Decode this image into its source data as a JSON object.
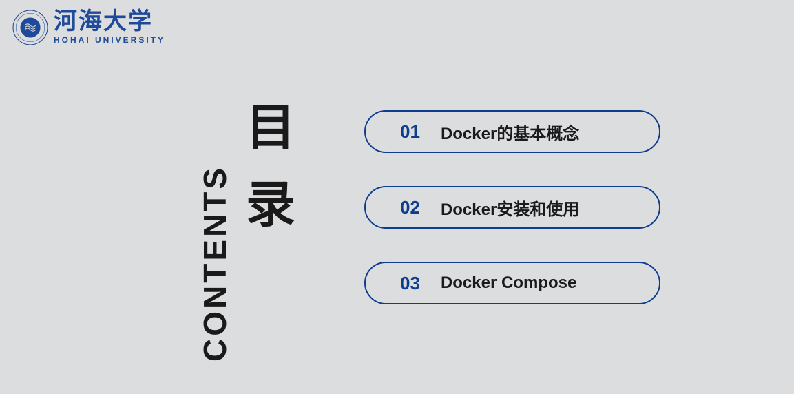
{
  "logo": {
    "cn": "河海大学",
    "en": "HOHAI UNIVERSITY"
  },
  "heading": {
    "cn_char1": "目",
    "cn_char2": "录",
    "en": "CONTENTS"
  },
  "toc": [
    {
      "num": "01",
      "title": "Docker的基本概念"
    },
    {
      "num": "02",
      "title": "Docker安装和使用"
    },
    {
      "num": "03",
      "title": "Docker Compose"
    }
  ],
  "colors": {
    "brand_blue": "#1f4a9a",
    "dark_blue": "#0f3d8e",
    "text_black": "#1a1a1a",
    "bg": "#dcdddf"
  }
}
